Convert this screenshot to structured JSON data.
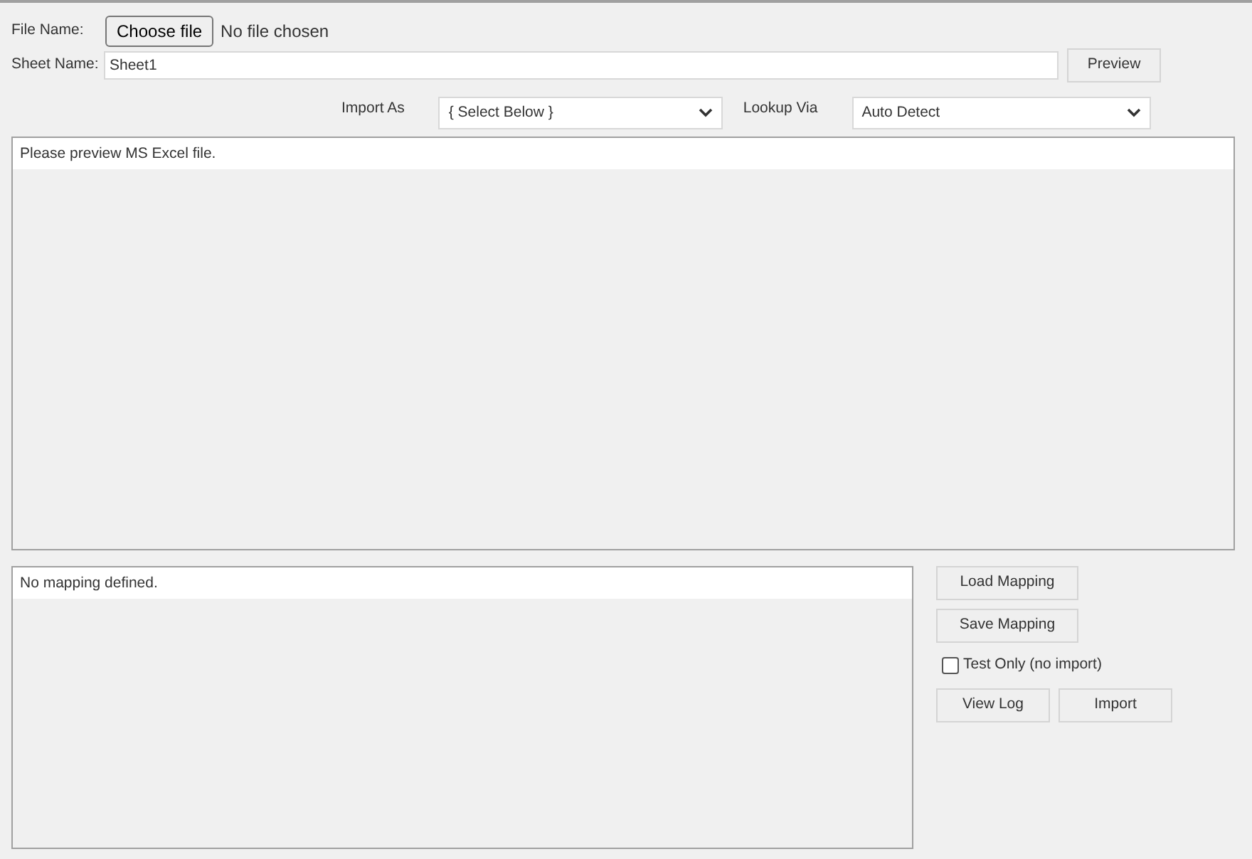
{
  "file_name": {
    "label": "File Name:",
    "button": "Choose file",
    "status": "No file chosen"
  },
  "sheet_name": {
    "label": "Sheet Name:",
    "value": "Sheet1",
    "button": "Preview"
  },
  "import_as": {
    "label": "Import As",
    "value": "{ Select Below }"
  },
  "lookup_via": {
    "label": "Lookup Via",
    "value": "Auto Detect"
  },
  "preview_panel": {
    "message": "Please preview MS Excel file."
  },
  "mapping_panel": {
    "message": "No mapping defined."
  },
  "actions": {
    "load_button": "Load Mapping",
    "save_button": "Save Mapping",
    "test_only": {
      "label": "Test Only (no import)",
      "checked": false
    },
    "view_log_button": "View Log",
    "import_button": "Import"
  }
}
